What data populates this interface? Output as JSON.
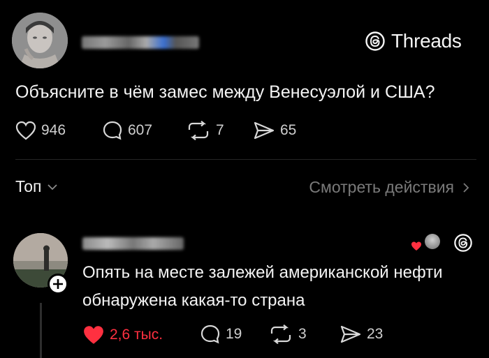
{
  "brand": {
    "label": "Threads"
  },
  "post": {
    "text": "Объясните в чём замес между Венесуэлой и США?",
    "likes": "946",
    "comments": "607",
    "reposts": "7",
    "shares": "65"
  },
  "sort": {
    "label": "Топ",
    "activity_label": "Смотреть действия"
  },
  "reply": {
    "text": "Опять на месте залежей американской нефти обнаружена какая-то страна",
    "likes": "2,6 тыс.",
    "comments": "19",
    "reposts": "3",
    "shares": "23",
    "liked_color": "#ff3040"
  },
  "icons": [
    "heart-icon",
    "comment-icon",
    "repost-icon",
    "share-icon",
    "threads-logo-icon",
    "chevron-down-icon",
    "chevron-right-icon",
    "plus-icon"
  ]
}
